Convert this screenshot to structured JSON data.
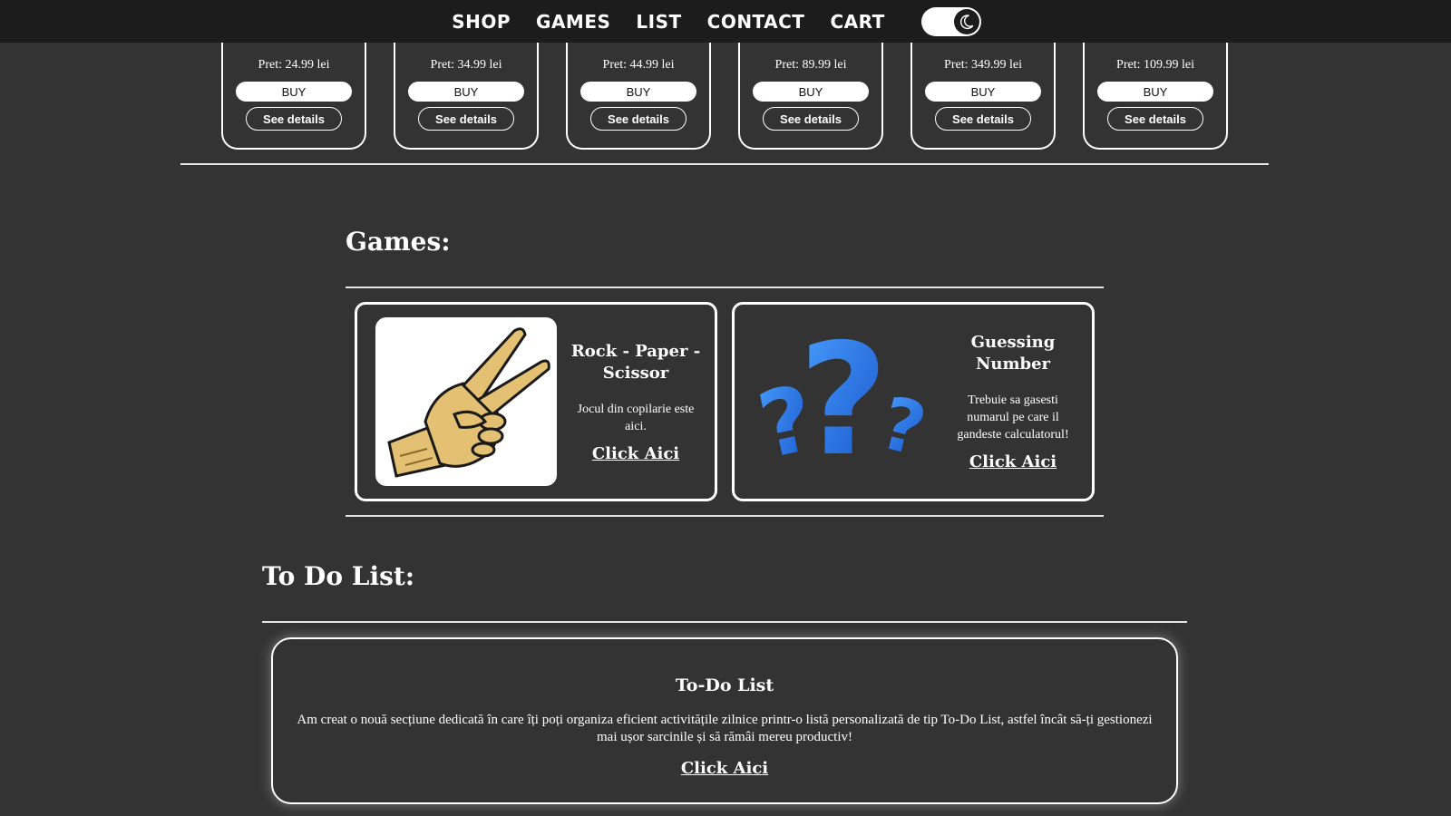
{
  "nav": {
    "links": [
      "SHOP",
      "GAMES",
      "LIST",
      "CONTACT",
      "CART"
    ],
    "theme_toggle_icon": "moon-icon"
  },
  "shop": {
    "products": [
      {
        "price": "Pret: 24.99 lei",
        "buy": "BUY",
        "details": "See details"
      },
      {
        "price": "Pret: 34.99 lei",
        "buy": "BUY",
        "details": "See details"
      },
      {
        "price": "Pret: 44.99 lei",
        "buy": "BUY",
        "details": "See details"
      },
      {
        "price": "Pret: 89.99 lei",
        "buy": "BUY",
        "details": "See details"
      },
      {
        "price": "Pret: 349.99 lei",
        "buy": "BUY",
        "details": "See details"
      },
      {
        "price": "Pret: 109.99 lei",
        "buy": "BUY",
        "details": "See details"
      }
    ]
  },
  "games": {
    "heading": "Games:",
    "cards": [
      {
        "title": "Rock - Paper - Scissor",
        "description": "Jocul din copilarie este aici.",
        "link": "Click Aici",
        "image": "peace-hand-icon"
      },
      {
        "title": "Guessing Number",
        "description": "Trebuie sa gasesti numarul pe care il gandeste calculatorul!",
        "link": "Click Aici",
        "image": "question-marks-icon"
      }
    ]
  },
  "todo": {
    "heading": "To Do List:",
    "card_title": "To-Do List",
    "description": "Am creat o nouă secțiune dedicată în care îți poți organiza eficient activitățile zilnice printr-o listă personalizată de tip To-Do List, astfel încât să-ți gestionezi mai ușor sarcinile și să rămâi mereu productiv!",
    "link": "Click Aici"
  },
  "colors": {
    "background": "#333333",
    "navbar": "#1c1c1c",
    "accent": "#ffffff",
    "question_blue": "#1e6fe0"
  }
}
